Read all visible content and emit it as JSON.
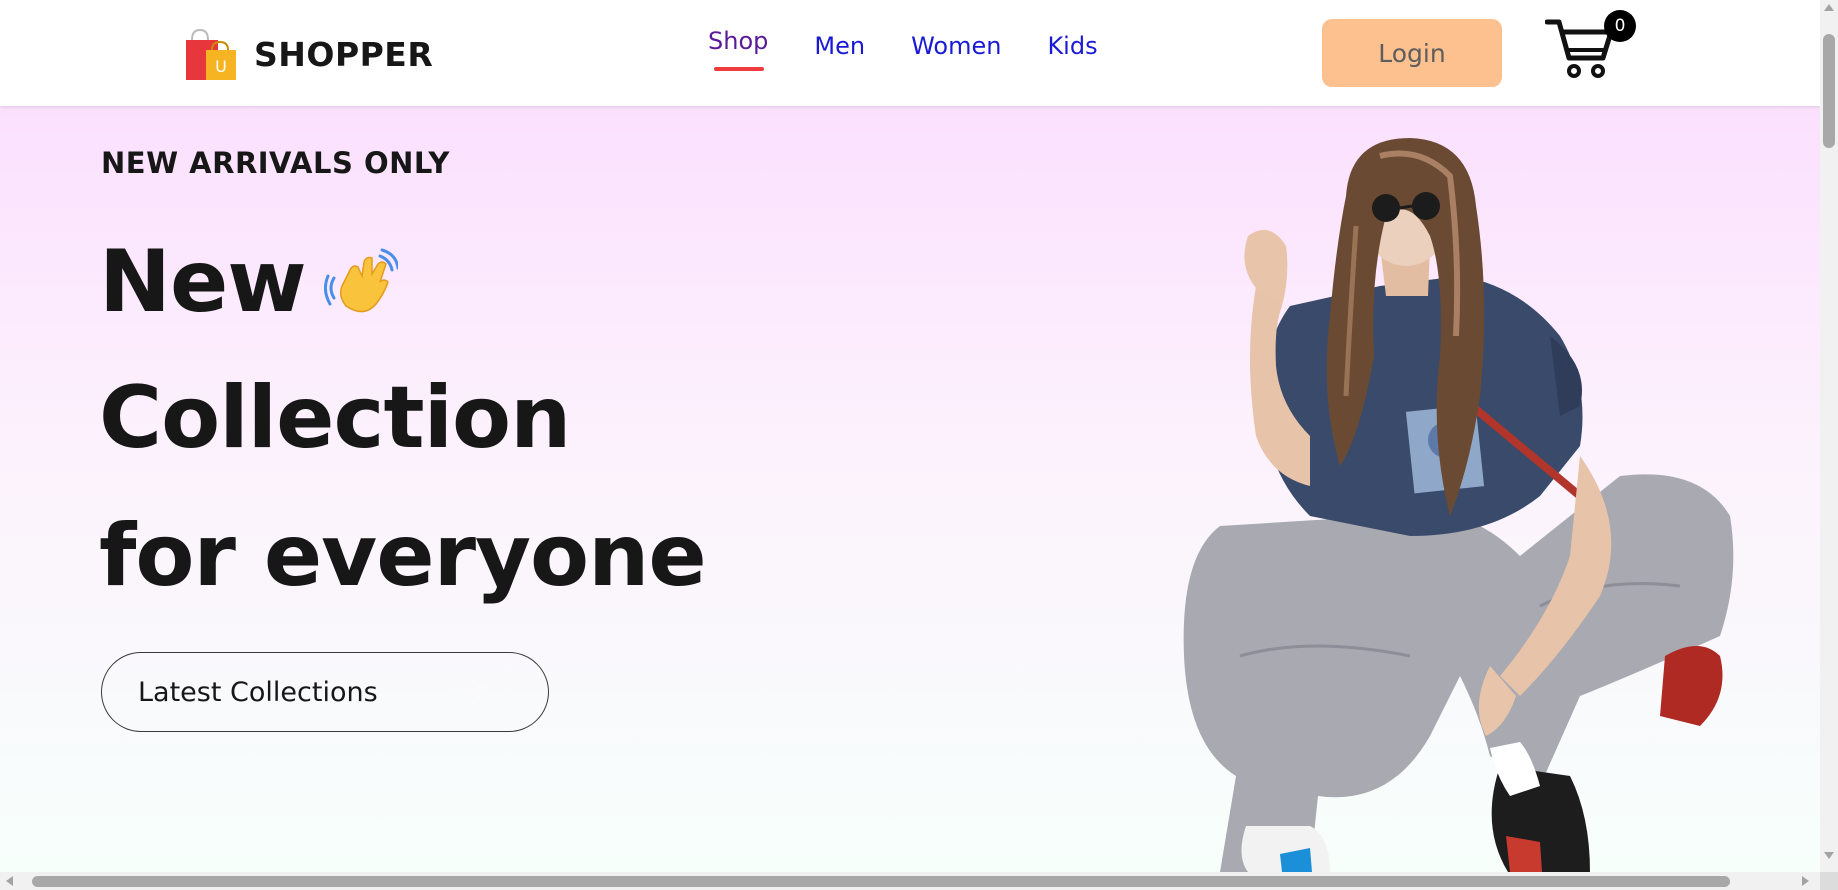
{
  "brand": {
    "name": "SHOPPER",
    "logo_icon": "shopping-bags-icon",
    "logo_badge": "U"
  },
  "nav": {
    "items": [
      {
        "label": "Shop",
        "active": true
      },
      {
        "label": "Men",
        "active": false
      },
      {
        "label": "Women",
        "active": false
      },
      {
        "label": "Kids",
        "active": false
      }
    ]
  },
  "header": {
    "login_label": "Login",
    "cart_icon": "shopping-cart-icon",
    "cart_count": "0"
  },
  "hero": {
    "eyebrow": "NEW ARRIVALS ONLY",
    "line1": "New",
    "line2": "Collection",
    "line3": "for everyone",
    "hand_icon": "waving-hand-icon",
    "cta_label": "Latest Collections",
    "cta_icon": "arrow-right-icon",
    "image": "hero-model-image"
  },
  "colors": {
    "accent_underline": "#ef3b3b",
    "login_bg": "#fcc18f",
    "nav_link": "#1a1ad6",
    "nav_active": "#5a1a9a",
    "hero_gradient_top": "#fbe0fe",
    "hero_gradient_bottom": "#f7fffb",
    "text_dark": "#171717"
  }
}
